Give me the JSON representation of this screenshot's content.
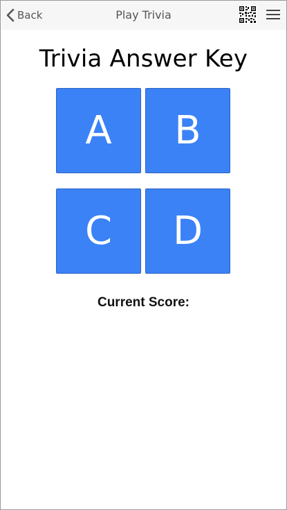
{
  "navbar": {
    "back_label": "Back",
    "title": "Play Trivia",
    "icons": {
      "back": "chevron-left-icon",
      "qr": "qr-code-icon",
      "menu": "hamburger-menu-icon"
    }
  },
  "main": {
    "title": "Trivia Answer Key",
    "answers": [
      "A",
      "B",
      "C",
      "D"
    ],
    "score_label": "Current Score:"
  },
  "colors": {
    "navbar_bg": "#f6f6f6",
    "button_bg": "#3b82f6",
    "button_text": "#ffffff"
  }
}
